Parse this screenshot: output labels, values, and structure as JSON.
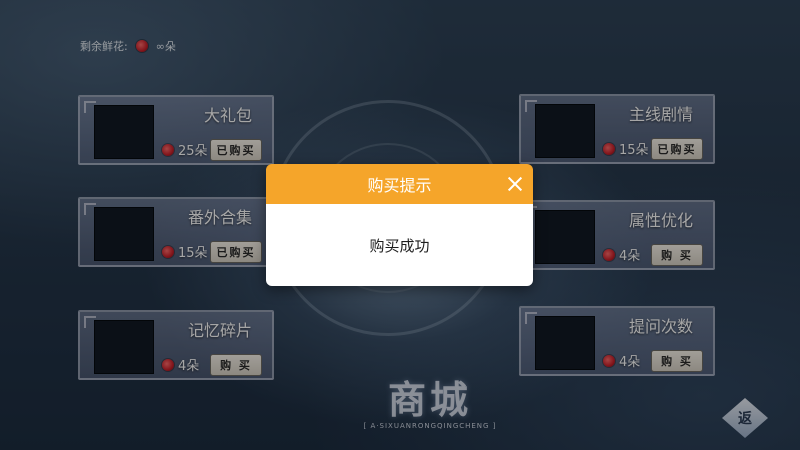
{
  "header": {
    "remaining_label": "剩余鲜花:",
    "remaining_value": "∞朵"
  },
  "items": [
    {
      "title": "大礼包",
      "price": "25朵",
      "button": "已购买"
    },
    {
      "title": "主线剧情",
      "price": "15朵",
      "button": "已购买"
    },
    {
      "title": "番外合集",
      "price": "15朵",
      "button": "已购买"
    },
    {
      "title": "属性优化",
      "price": "4朵",
      "button": "购 买"
    },
    {
      "title": "记忆碎片",
      "price": "4朵",
      "button": "购 买"
    },
    {
      "title": "提问次数",
      "price": "4朵",
      "button": "购 买"
    }
  ],
  "dialog": {
    "title": "购买提示",
    "message": "购买成功"
  },
  "logo": {
    "title": "商城",
    "subtitle": "[ A·SIXUANRONGQINGCHENG ]"
  },
  "back_button": "返",
  "colors": {
    "dialog_header": "#f5a52a",
    "button_bg": "#f0ebe0"
  }
}
